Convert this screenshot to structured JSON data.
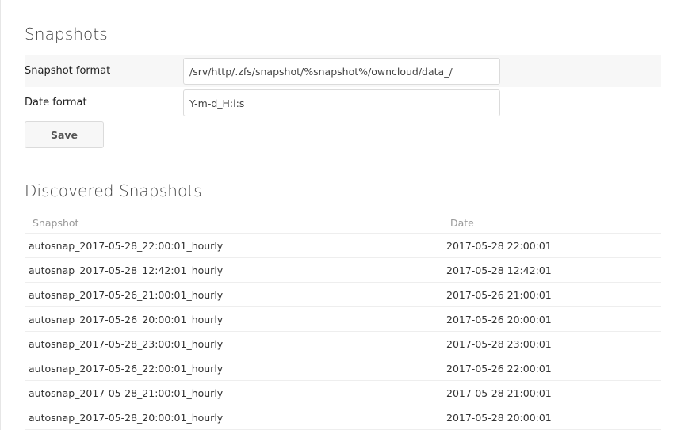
{
  "snapshots_section": {
    "title": "Snapshots",
    "snapshot_format": {
      "label": "Snapshot format",
      "value": "/srv/http/.zfs/snapshot/%snapshot%/owncloud/data_/"
    },
    "date_format": {
      "label": "Date format",
      "value": "Y-m-d_H:i:s"
    },
    "save_label": "Save"
  },
  "discovered_section": {
    "title": "Discovered Snapshots",
    "columns": {
      "snapshot": "Snapshot",
      "date": "Date"
    },
    "rows": [
      {
        "name": "autosnap_2017-05-28_22:00:01_hourly",
        "date": "2017-05-28 22:00:01"
      },
      {
        "name": "autosnap_2017-05-28_12:42:01_hourly",
        "date": "2017-05-28 12:42:01"
      },
      {
        "name": "autosnap_2017-05-26_21:00:01_hourly",
        "date": "2017-05-26 21:00:01"
      },
      {
        "name": "autosnap_2017-05-26_20:00:01_hourly",
        "date": "2017-05-26 20:00:01"
      },
      {
        "name": "autosnap_2017-05-28_23:00:01_hourly",
        "date": "2017-05-28 23:00:01"
      },
      {
        "name": "autosnap_2017-05-26_22:00:01_hourly",
        "date": "2017-05-26 22:00:01"
      },
      {
        "name": "autosnap_2017-05-28_21:00:01_hourly",
        "date": "2017-05-28 21:00:01"
      },
      {
        "name": "autosnap_2017-05-28_20:00:01_hourly",
        "date": "2017-05-28 20:00:01"
      }
    ]
  }
}
